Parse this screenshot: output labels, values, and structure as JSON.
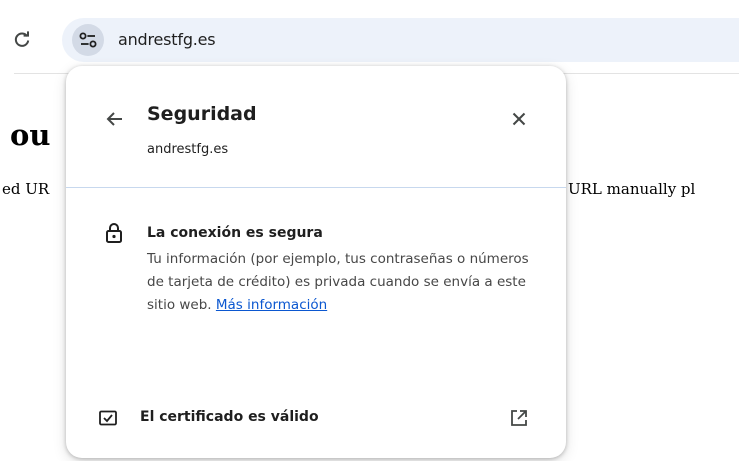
{
  "browser": {
    "url": "andrestfg.es"
  },
  "page": {
    "heading_fragment": "ou",
    "text_left_fragment": "ed UR",
    "text_right_fragment": "URL manually pl"
  },
  "popup": {
    "title": "Seguridad",
    "subtitle": "andrestfg.es",
    "connection": {
      "title": "La conexión es segura",
      "description": "Tu información (por ejemplo, tus contraseñas o números de tarjeta de crédito) es privada cuando se envía a este sitio web. ",
      "link_text": "Más información"
    },
    "certificate": {
      "label": "El certificado es válido"
    }
  },
  "icons": {
    "reload": "reload-icon",
    "site_info": "tune-icon",
    "back": "arrow-left-icon",
    "close": "close-icon",
    "lock": "lock-icon",
    "certificate": "certificate-icon",
    "external": "open-external-icon"
  },
  "colors": {
    "omnibox_bg": "#edf2fa",
    "link": "#0b57d0",
    "separator": "#c7d8ee"
  }
}
